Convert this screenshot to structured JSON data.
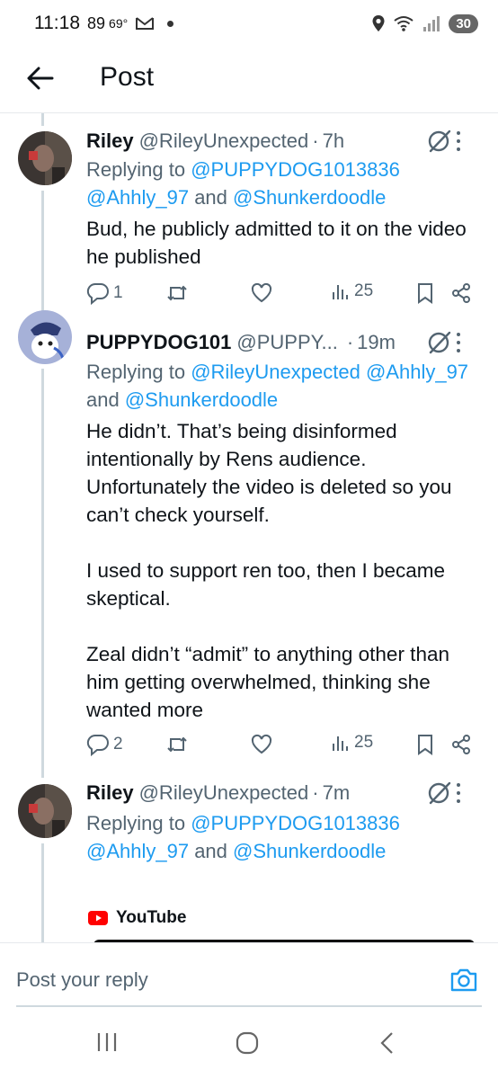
{
  "status_bar": {
    "time": "11:18",
    "extra": "89",
    "temp": "69°",
    "battery": "30"
  },
  "header": {
    "title": "Post"
  },
  "tweets": [
    {
      "name": "Riley",
      "handle": "@RileyUnexpected",
      "time": "7h",
      "reply_prefix": "Replying to ",
      "mention1": "@PUPPYDOG1013836",
      "mention2": "@Ahhly_97",
      "and": " and ",
      "mention3": "@Shunkerdoodle",
      "paragraphs": [
        "Bud, he publicly admitted to it on the video he published"
      ],
      "replies": "1",
      "views": "25"
    },
    {
      "name": "PUPPYDOG101",
      "handle": "@PUPPY...",
      "time": "19m",
      "reply_prefix": "Replying to ",
      "mention1": "@RileyUnexpected",
      "mention2": "@Ahhly_97",
      "and": "and ",
      "mention3": "@Shunkerdoodle",
      "paragraphs": [
        "He didn’t. That’s being disinformed intentionally by Rens audience. Unfortunately the video is deleted so you can’t check yourself.",
        "I used to support ren too, then I became skeptical.",
        "Zeal didn’t “admit” to anything other than him getting overwhelmed, thinking she wanted more"
      ],
      "replies": "2",
      "views": "25"
    },
    {
      "name": "Riley",
      "handle": "@RileyUnexpected",
      "time": "7m",
      "reply_prefix": "Replying to ",
      "mention1": "@PUPPYDOG1013836",
      "mention2": "@Ahhly_97",
      "and": " and ",
      "mention3": "@Shunkerdoodle",
      "embed_label": "YouTube"
    }
  ],
  "compose": {
    "placeholder": "Post your reply"
  },
  "icons": {
    "back": "arrow-left-icon",
    "grok": "grok-icon",
    "more": "more-vertical-icon",
    "reply": "reply-icon",
    "repost": "repost-icon",
    "like": "heart-icon",
    "views": "views-icon",
    "bookmark": "bookmark-icon",
    "share": "share-icon",
    "camera": "camera-icon"
  },
  "colors": {
    "link": "#1d9bf0",
    "secondary": "#536471"
  }
}
